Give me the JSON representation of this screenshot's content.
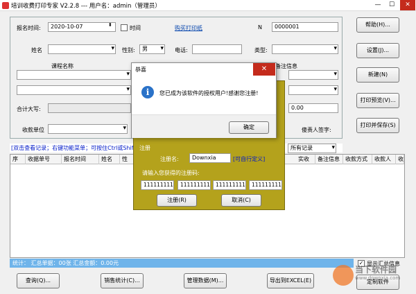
{
  "window": {
    "title": "培训收费打印专家 V2.2.8 --- 用户名：admin（管理员）",
    "minimize": "—",
    "maximize": "☐",
    "close": "✕"
  },
  "form": {
    "date_label": "报名时间:",
    "date_value": "2020-10-07",
    "time_label": "时间",
    "buy_paper_link": "购买打印纸",
    "no_label": "N",
    "no_value": "0000001",
    "name_label": "姓名",
    "gender_label": "性别:",
    "gender_value": "男",
    "phone_label": "电话:",
    "type_label": "类型:",
    "course_label": "课程名称",
    "remark_label": "备注信息",
    "total_label": "合计大写:",
    "amount_value": "0.00",
    "unit_label": "收款单位",
    "handler_label": "傻责人签字:"
  },
  "buttons": {
    "help": "帮助(H)...",
    "settings": "设置(J)...",
    "new": "新建(N)",
    "preview": "打印预览(V)...",
    "print_save": "打印并保存(S)",
    "query": "查询(Q)...",
    "sales_stats": "销售统计(C)...",
    "manage_data": "管理数据(M)...",
    "export_excel": "导出到EXCEL(E)",
    "customize": "定制软件"
  },
  "hint_line": "[双击查看记录；右键功能菜单；可按住Ctrl或Shift键",
  "filter": {
    "value": "所有记录"
  },
  "table": {
    "columns": [
      "序",
      "收据单号",
      "报名时间",
      "姓名",
      "性",
      "实收",
      "备注信息",
      "收款方式",
      "收款人",
      "收"
    ]
  },
  "status": {
    "text": "统计：  汇总单据：00张      汇总金额：0.00元"
  },
  "show_summary": {
    "label": "显示汇总信息",
    "checked": true
  },
  "register": {
    "section_label": "注册",
    "username_label": "注册名:",
    "username_value": "Downxia",
    "customizable": "[可自行定义]",
    "code_label": "请输入您获得的注册码:",
    "codes": [
      "111111111",
      "111111111",
      "111111111",
      "111111111"
    ],
    "register_btn": "注册(R)",
    "cancel_btn": "取消(C)"
  },
  "dialog": {
    "title": "恭喜",
    "close": "✕",
    "message": "您已成为该软件的授权用户!感谢您注册!",
    "ok": "确定"
  },
  "watermark": {
    "line1": "当下软件园",
    "line2": "www.downxia.com"
  },
  "colors": {
    "status_bar": "#6fb4ea",
    "register_panel": "#b4a21c",
    "link": "#0645ad",
    "close": "#c42b1c"
  }
}
